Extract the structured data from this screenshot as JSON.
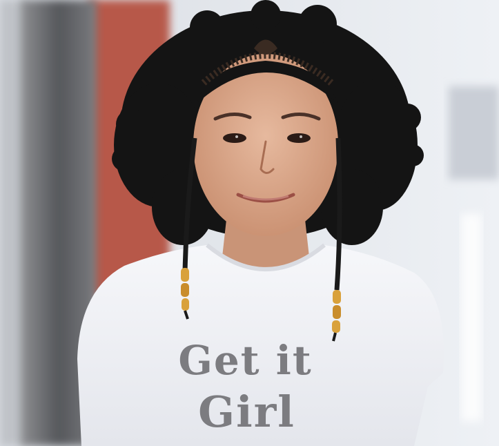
{
  "photo": {
    "shirt_text_line_1": "Get it",
    "shirt_text_line_2": "Girl",
    "colors": {
      "background": "#e9edf2",
      "red_wall": "#b7584a",
      "shirt": "#f2f3f6",
      "shirt_print": "#7c7c80",
      "hair": "#141414",
      "skin": "#d8a98d",
      "beads": "#d9a13b"
    }
  }
}
